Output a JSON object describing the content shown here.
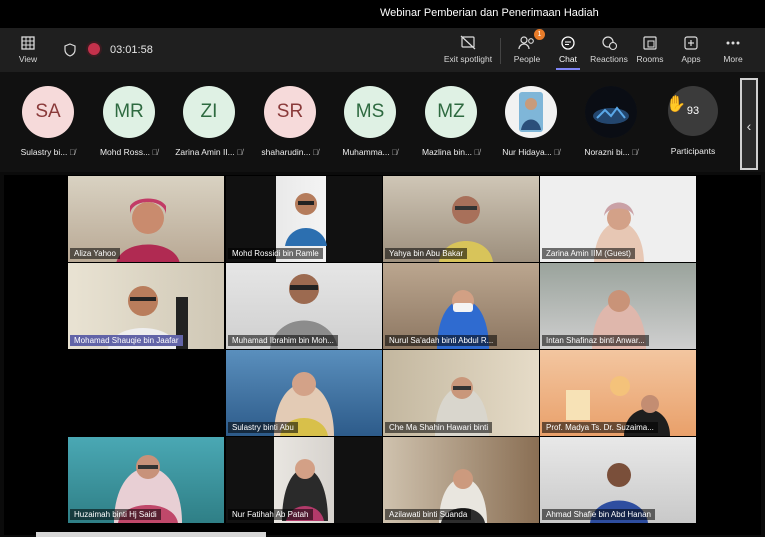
{
  "window": {
    "title": "Webinar Pemberian dan Penerimaan Hadiah"
  },
  "toolbar": {
    "view_label": "View",
    "timer": "03:01:58",
    "exit_spotlight_label": "Exit spotlight",
    "people_label": "People",
    "people_badge": "1",
    "chat_label": "Chat",
    "reactions_label": "Reactions",
    "rooms_label": "Rooms",
    "apps_label": "Apps",
    "more_label": "More"
  },
  "participants_strip": [
    {
      "initials": "SA",
      "name": "Sulastry bi...",
      "color": "pink"
    },
    {
      "initials": "MR",
      "name": "Mohd Ross...",
      "color": "green"
    },
    {
      "initials": "ZI",
      "name": "Zarina Amin II...",
      "color": "green"
    },
    {
      "initials": "SR",
      "name": "shaharudin...",
      "color": "pink"
    },
    {
      "initials": "MS",
      "name": "Muhamma...",
      "color": "green"
    },
    {
      "initials": "MZ",
      "name": "Mazlina bin...",
      "color": "green"
    },
    {
      "initials": "",
      "name": "Nur Hidaya...",
      "color": "photo"
    },
    {
      "initials": "",
      "name": "Norazni bi...",
      "color": "photo"
    }
  ],
  "participants_count": {
    "count": "93",
    "label": "Participants"
  },
  "video_tiles": [
    {
      "name": "Aliza Yahoo"
    },
    {
      "name": "Mohd Rossidi bin Ramle"
    },
    {
      "name": "Yahya bin Abu Bakar"
    },
    {
      "name": "Zarina Amin IIM (Guest)"
    },
    {
      "name": "Mohamad Shauqie bin  Jaafar"
    },
    {
      "name": "Muhamad Ibrahim bin Moh..."
    },
    {
      "name": "Nurul Sa'adah binti Abdul R..."
    },
    {
      "name": "Intan Shafinaz binti Anwar..."
    },
    {
      "name": "Sulastry binti Abu"
    },
    {
      "name": "Che Ma Shahin Hawari binti"
    },
    {
      "name": "Prof. Madya Ts. Dr. Suzaima..."
    },
    {
      "name": "Huzaimah binti Hj Saidi"
    },
    {
      "name": "Nur Fatihah Ab Patah"
    },
    {
      "name": "Azilawati binti Suanda"
    },
    {
      "name": "Ahmad Shafie bin Abd Hanan"
    }
  ],
  "colors": {
    "accent": "#7f85f5",
    "record": "#c4314b",
    "badge": "#e87c2a"
  }
}
